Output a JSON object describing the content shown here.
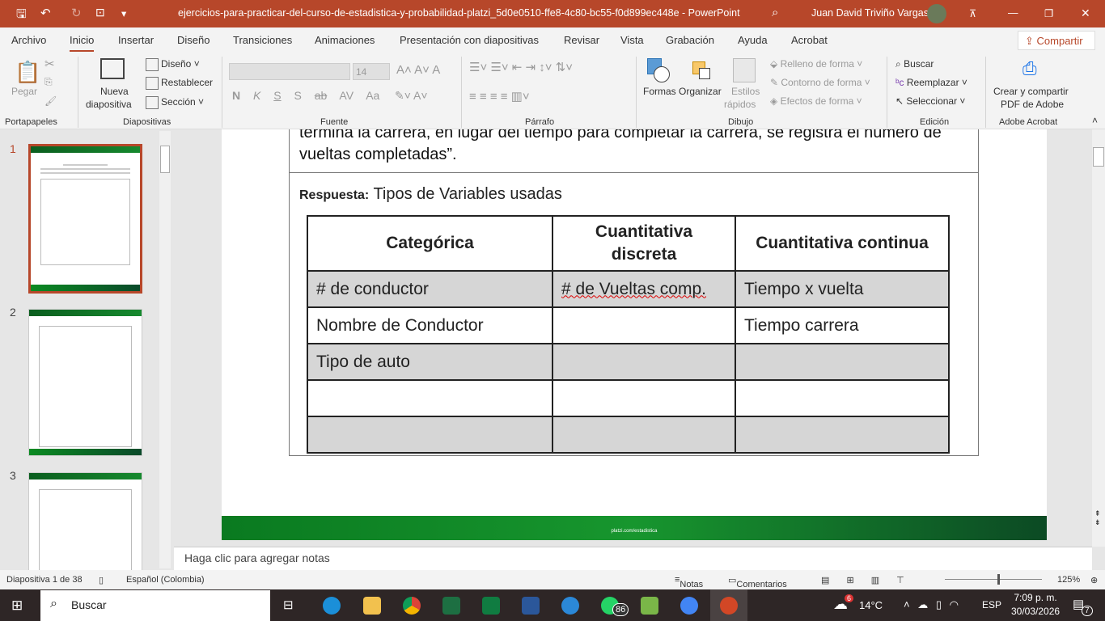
{
  "titlebar": {
    "title": "ejercicios-para-practicar-del-curso-de-estadistica-y-probabilidad-platzi_5d0e0510-ffe8-4c80-bc55-f0d899ec448e  -  PowerPoint",
    "user": "Juan David Triviño Vargas"
  },
  "tabs": [
    "Archivo",
    "Inicio",
    "Insertar",
    "Diseño",
    "Transiciones",
    "Animaciones",
    "Presentación con diapositivas",
    "Revisar",
    "Vista",
    "Grabación",
    "Ayuda",
    "Acrobat"
  ],
  "share": "Compartir",
  "ribbon": {
    "paste": "Pegar",
    "new_slide_1": "Nueva",
    "new_slide_2": "diapositiva",
    "layout": "Diseño",
    "reset": "Restablecer",
    "section": "Sección",
    "font_size": "14",
    "font_buttons": [
      "N",
      "K",
      "S",
      "S",
      "ab",
      "AV",
      "Aa"
    ],
    "shapes": "Formas",
    "arrange": "Organizar",
    "quick_styles_1": "Estilos",
    "quick_styles_2": "rápidos",
    "fill": "Relleno de forma",
    "outline": "Contorno de forma",
    "effects": "Efectos de forma",
    "find": "Buscar",
    "replace": "Reemplazar",
    "select": "Seleccionar",
    "acrobat_1": "Crear y compartir",
    "acrobat_2": "PDF de Adobe",
    "groups": [
      "Portapapeles",
      "Diapositivas",
      "Fuente",
      "Párrafo",
      "Dibujo",
      "Edición",
      "Adobe Acrobat"
    ]
  },
  "thumbnails": [
    {
      "num": "1"
    },
    {
      "num": "2"
    },
    {
      "num": "3"
    }
  ],
  "slide": {
    "paragraph_1": "termina la carrera, en lugar del tiempo para completar la carrera, se registra el número de",
    "paragraph_2": "vueltas completadas”.",
    "answer_label": "Respuesta:",
    "answer_text": " Tipos de  Variables usadas",
    "table": {
      "headers": [
        "Categórica",
        "Cuantitativa discreta",
        "Cuantitativa continua"
      ],
      "rows": [
        [
          "# de conductor",
          "# de Vueltas comp.",
          "Tiempo x vuelta"
        ],
        [
          "Nombre de Conductor",
          "",
          "Tiempo carrera"
        ],
        [
          "Tipo de auto",
          "",
          ""
        ],
        [
          "",
          "",
          ""
        ],
        [
          "",
          "",
          ""
        ]
      ]
    },
    "footer": "platzi.com/estadistica"
  },
  "notes_placeholder": "Haga clic para agregar notas",
  "status": {
    "slide": "Diapositiva 1 de 38",
    "language": "Español (Colombia)",
    "notes": "Notas",
    "comments": "Comentarios",
    "zoom": "125%"
  },
  "taskbar": {
    "search": "Buscar",
    "whatsapp_badge": "86",
    "weather_badge": "6",
    "temp": "14°C",
    "lang": "ESP",
    "time": "7:09 p. m.",
    "date": "30/03/2026",
    "notif": "7"
  }
}
